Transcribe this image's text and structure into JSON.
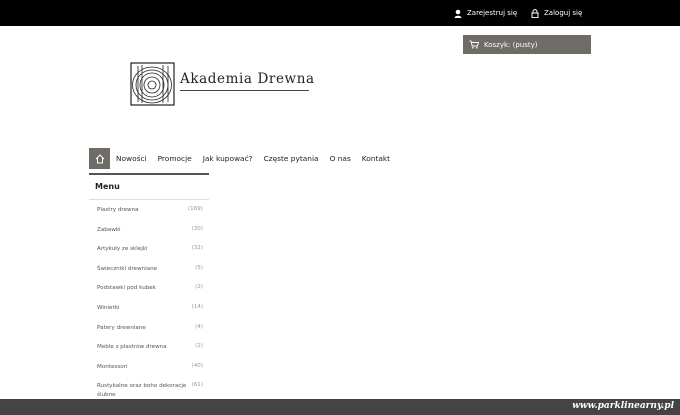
{
  "topbar": {
    "register_label": "Zarejestruj się",
    "login_label": "Zaloguj się"
  },
  "cart": {
    "label": "Koszyk: (pusty)"
  },
  "logo": {
    "text": "Akademia Drewna"
  },
  "nav": {
    "items": [
      "Nowości",
      "Promocje",
      "Jak kupować?",
      "Częste pytania",
      "O nas",
      "Kontakt"
    ]
  },
  "sidebar": {
    "title": "Menu",
    "items": [
      {
        "label": "Plastry drewna",
        "count": "(169)"
      },
      {
        "label": "Zabawki",
        "count": "(30)"
      },
      {
        "label": "Artykuły ze sklejki",
        "count": "(32)"
      },
      {
        "label": "Świeczniki drewniane",
        "count": "(5)"
      },
      {
        "label": "Podstawki pod kubek",
        "count": "(2)"
      },
      {
        "label": "Winietki",
        "count": "(14)"
      },
      {
        "label": "Patery drewniane",
        "count": "(4)"
      },
      {
        "label": "Meble z plastrów drewna",
        "count": "(2)"
      },
      {
        "label": "Montessori",
        "count": "(40)"
      },
      {
        "label": "Rustykalne oraz boho dekoracje ślubne",
        "count": "(61)"
      }
    ]
  },
  "watermark": "www.parklinearny.pl",
  "colors": {
    "topbar": "#000000",
    "accent": "#6f6b66"
  }
}
